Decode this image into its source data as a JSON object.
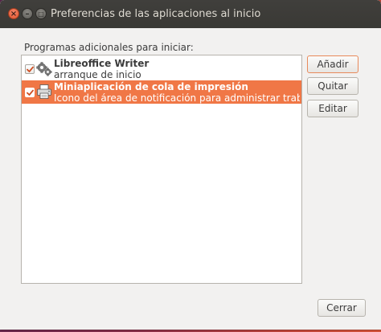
{
  "window": {
    "title": "Preferencias de las aplicaciones al inicio",
    "controls": {
      "close": "×",
      "minimize": "–",
      "maximize": "□"
    }
  },
  "section_label": "Programas adicionales para iniciar:",
  "startup_programs": [
    {
      "name": "Libreoffice Writer",
      "comment": "arranque de inicio",
      "enabled": true,
      "selected": false,
      "icon": "gears-icon"
    },
    {
      "name": "Miniaplicación de cola de impresión",
      "comment": "Icono del área de notificación para administrar trabajos …",
      "enabled": true,
      "selected": true,
      "icon": "printer-icon"
    }
  ],
  "buttons": {
    "add": "Añadir",
    "remove": "Quitar",
    "edit": "Editar",
    "close": "Cerrar"
  },
  "colors": {
    "selection": "#f07746",
    "titlebar": "#3c3b37",
    "window_bg": "#f2f1f0",
    "close_button": "#e95420"
  }
}
